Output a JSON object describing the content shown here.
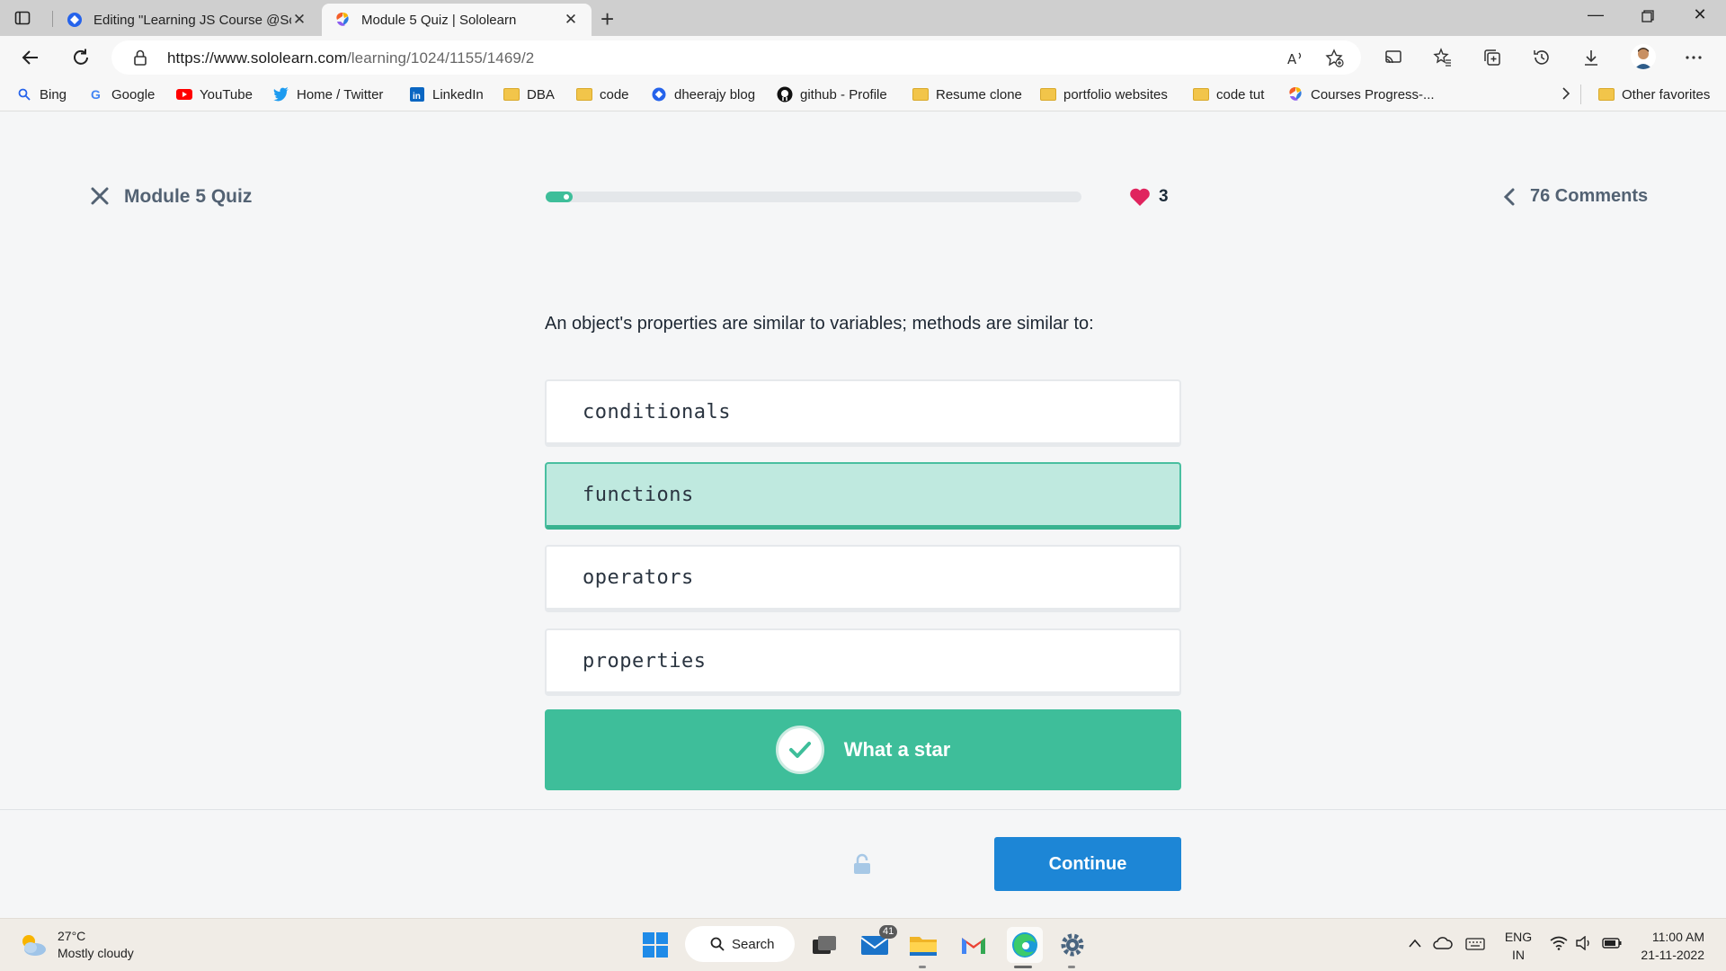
{
  "browser": {
    "tabs": [
      {
        "title": "Editing \"Learning JS Course @Sc",
        "active": false
      },
      {
        "title": "Module 5 Quiz | Sololearn",
        "active": true
      }
    ],
    "url_domain": "https://www.sololearn.com",
    "url_path": "/learning/1024/1155/1469/2",
    "bookmarks": [
      {
        "label": "Bing",
        "icon": "search-icon"
      },
      {
        "label": "Google",
        "icon": "google-icon"
      },
      {
        "label": "YouTube",
        "icon": "youtube-icon"
      },
      {
        "label": "Home / Twitter",
        "icon": "twitter-icon"
      },
      {
        "label": "LinkedIn",
        "icon": "linkedin-icon"
      },
      {
        "label": "DBA",
        "icon": "folder-icon"
      },
      {
        "label": "code",
        "icon": "folder-icon"
      },
      {
        "label": "dheerajy blog",
        "icon": "blog-icon"
      },
      {
        "label": "github - Profile",
        "icon": "github-icon"
      },
      {
        "label": "Resume clone",
        "icon": "folder-icon"
      },
      {
        "label": "portfolio websites",
        "icon": "folder-icon"
      },
      {
        "label": "code tut",
        "icon": "folder-icon"
      },
      {
        "label": "Courses Progress-...",
        "icon": "sololearn-icon"
      }
    ],
    "other_favorites": "Other favorites"
  },
  "quiz": {
    "title": "Module 5 Quiz",
    "progress": 0.05,
    "lives": "3",
    "comments": "76 Comments",
    "question": "An object's properties are similar to variables; methods are similar to:",
    "options": [
      {
        "label": "conditionals",
        "selected": false
      },
      {
        "label": "functions",
        "selected": true
      },
      {
        "label": "operators",
        "selected": false
      },
      {
        "label": "properties",
        "selected": false
      }
    ],
    "feedback": "What a star",
    "continue_label": "Continue",
    "colors": {
      "accent": "#3ebe9a",
      "button": "#1d86d6",
      "heart": "#e0245e"
    }
  },
  "taskbar": {
    "temperature": "27°C",
    "weather": "Mostly cloudy",
    "search_label": "Search",
    "mail_badge": "41",
    "lang_line1": "ENG",
    "lang_line2": "IN",
    "time": "11:00 AM",
    "date": "21-11-2022"
  }
}
